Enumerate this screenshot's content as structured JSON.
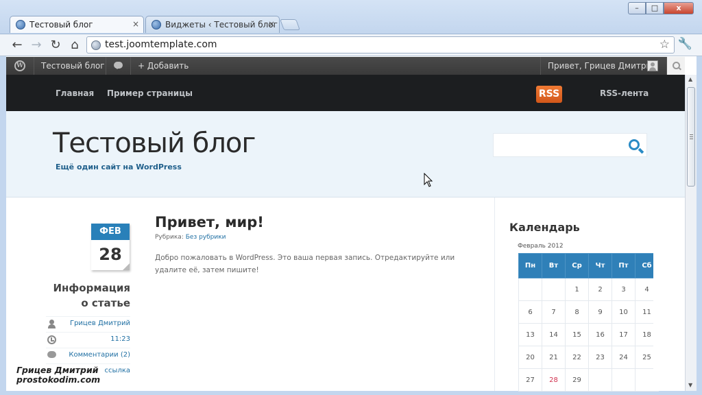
{
  "browser": {
    "tabs": [
      {
        "label": "Тестовый блог",
        "active": true
      },
      {
        "label": "Виджеты ‹ Тестовый блог",
        "active": false
      }
    ],
    "tab_close": "×",
    "url": "test.joomtemplate.com",
    "window_buttons": {
      "minimize": "–",
      "maximize": "□",
      "close": "x"
    },
    "nav": {
      "back": "←",
      "forward": "→",
      "reload": "↻",
      "home": "⌂",
      "star": "☆",
      "wrench": "🔧"
    }
  },
  "adminbar": {
    "logo": "W",
    "site_name": "Тестовый блог",
    "add_label": "+ Добавить",
    "greeting": "Привет, Грицев Дмитрий"
  },
  "site": {
    "nav": [
      "Главная",
      "Пример страницы"
    ],
    "rss_badge": "RSS",
    "rss_label": "RSS-лента",
    "title": "Тестовый блог",
    "tagline": "Ещё один сайт на WordPress"
  },
  "post": {
    "month": "ФЕВ",
    "day": "28",
    "meta_heading_line1": "Информация",
    "meta_heading_line2": "о статье",
    "author": "Грицев Дмитрий",
    "time": "11:23",
    "comments": "Комментарии (2)",
    "permalink": "ссылка",
    "title": "Привет, мир!",
    "category_prefix": "Рубрика:",
    "category": "Без рубрики",
    "body": "Добро пожаловать в WordPress. Это ваша первая запись. Отредактируйте или удалите её, затем пишите!"
  },
  "sidebar": {
    "widget_title": "Календарь",
    "calendar_caption": "Февраль 2012",
    "weekdays": [
      "Пн",
      "Вт",
      "Ср",
      "Чт",
      "Пт",
      "Сб"
    ],
    "rows": [
      [
        "",
        "",
        "1",
        "2",
        "3",
        "4"
      ],
      [
        "6",
        "7",
        "8",
        "9",
        "10",
        "11"
      ],
      [
        "13",
        "14",
        "15",
        "16",
        "17",
        "18"
      ],
      [
        "20",
        "21",
        "22",
        "23",
        "24",
        "25"
      ],
      [
        "27",
        "28",
        "29",
        "",
        "",
        ""
      ]
    ],
    "today": "28"
  },
  "watermark": {
    "line1": "Грицев Дмитрий",
    "line2": "prostokodim.com"
  },
  "colors": {
    "accent": "#2980b9",
    "nav_bg": "#1c1e20",
    "rss": "#e06a2a"
  }
}
